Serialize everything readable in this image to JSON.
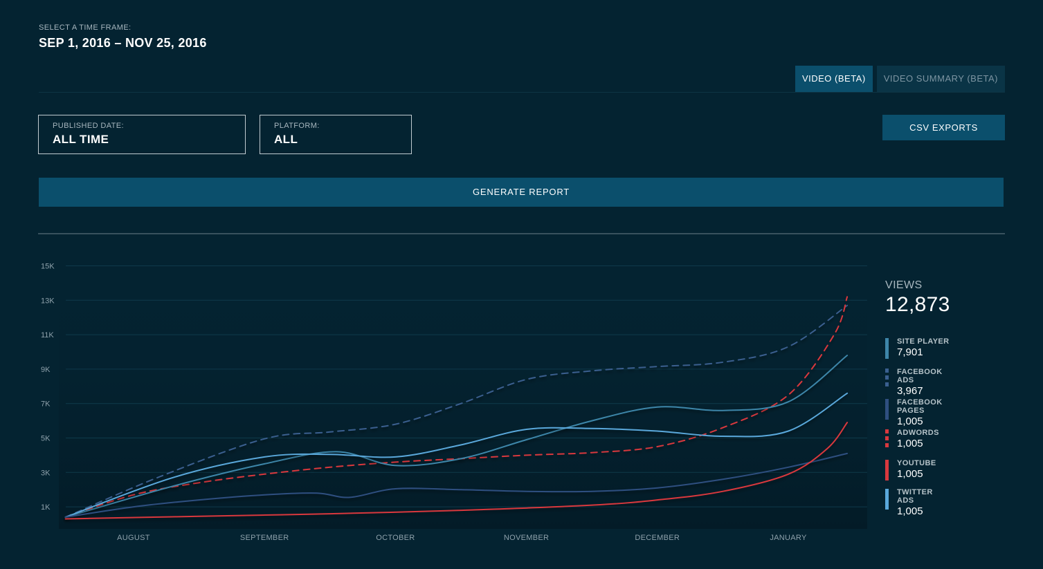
{
  "header": {
    "timeframe_label": "SELECT A TIME FRAME:",
    "timeframe_value": "SEP 1, 2016 – NOV 25, 2016"
  },
  "tabs": [
    {
      "label": "VIDEO (BETA)",
      "active": true
    },
    {
      "label": "VIDEO SUMMARY (BETA)",
      "active": false
    }
  ],
  "filters": {
    "published_date": {
      "label": "PUBLISHED DATE:",
      "value": "ALL TIME"
    },
    "platform": {
      "label": "PLATFORM:",
      "value": "ALL"
    }
  },
  "buttons": {
    "csv_exports": "CSV EXPORTS",
    "generate_report": "GENERATE REPORT"
  },
  "legend": {
    "title": "VIEWS",
    "total": "12,873",
    "items": [
      {
        "name": "SITE PLAYER",
        "value": "7,901",
        "color": "#3e86a9",
        "dashed": false
      },
      {
        "name": "FACEBOOK ADS",
        "value": "3,967",
        "color": "#3a5f8f",
        "dashed": true
      },
      {
        "name": "FACEBOOK PAGES",
        "value": "1,005",
        "color": "#2f4f80",
        "dashed": false
      },
      {
        "name": "ADWORDS",
        "value": "1,005",
        "color": "#d9383e",
        "dashed": true
      },
      {
        "name": "YOUTUBE",
        "value": "1,005",
        "color": "#d9383e",
        "dashed": false
      },
      {
        "name": "TWITTER ADS",
        "value": "1,005",
        "color": "#5aa8db",
        "dashed": false
      }
    ]
  },
  "colors": {
    "background": "#042331",
    "accent": "#0b4f6c",
    "gridline": "#0f3a4b"
  },
  "chart_data": {
    "type": "line",
    "x_tick_labels": [
      "AUGUST",
      "SEPTEMBER",
      "OCTOBER",
      "NOVEMBER",
      "DECEMBER",
      "JANUARY"
    ],
    "y_tick_labels": [
      "1K",
      "3K",
      "5K",
      "7K",
      "9K",
      "11K",
      "13K",
      "15K"
    ],
    "y_ticks": [
      1000,
      3000,
      5000,
      7000,
      9000,
      11000,
      13000,
      15000
    ],
    "ylim": [
      0,
      15000
    ],
    "xlim": [
      0,
      5.55
    ],
    "grid": true,
    "legend_position": "right",
    "series": [
      {
        "name": "FACEBOOK ADS",
        "color": "#3a5f8f",
        "dashed": true,
        "points": [
          [
            -0.52,
            400
          ],
          [
            0.2,
            2750
          ],
          [
            1.0,
            4950
          ],
          [
            1.5,
            5350
          ],
          [
            2.0,
            5800
          ],
          [
            2.5,
            7000
          ],
          [
            3.0,
            8400
          ],
          [
            3.5,
            8900
          ],
          [
            4.0,
            9150
          ],
          [
            4.5,
            9400
          ],
          [
            5.0,
            10300
          ],
          [
            5.45,
            12700
          ]
        ]
      },
      {
        "name": "ADWORDS",
        "color": "#d9383e",
        "dashed": true,
        "points": [
          [
            -0.52,
            400
          ],
          [
            0.0,
            1700
          ],
          [
            0.5,
            2400
          ],
          [
            1.0,
            2900
          ],
          [
            1.5,
            3300
          ],
          [
            2.0,
            3600
          ],
          [
            2.5,
            3800
          ],
          [
            3.0,
            4000
          ],
          [
            3.5,
            4150
          ],
          [
            4.0,
            4500
          ],
          [
            4.5,
            5600
          ],
          [
            5.0,
            7500
          ],
          [
            5.35,
            11000
          ],
          [
            5.45,
            13200
          ]
        ]
      },
      {
        "name": "SITE PLAYER",
        "color": "#3e86a9",
        "dashed": false,
        "points": [
          [
            -0.52,
            400
          ],
          [
            0.3,
            2200
          ],
          [
            1.0,
            3500
          ],
          [
            1.55,
            4200
          ],
          [
            2.0,
            3400
          ],
          [
            2.5,
            3800
          ],
          [
            3.0,
            4900
          ],
          [
            3.5,
            6000
          ],
          [
            4.0,
            6800
          ],
          [
            4.5,
            6600
          ],
          [
            5.0,
            7100
          ],
          [
            5.45,
            9800
          ]
        ]
      },
      {
        "name": "TWITTER ADS",
        "color": "#5aa8db",
        "dashed": false,
        "points": [
          [
            -0.52,
            400
          ],
          [
            0.3,
            2700
          ],
          [
            1.0,
            3900
          ],
          [
            1.5,
            4050
          ],
          [
            2.0,
            3900
          ],
          [
            2.5,
            4600
          ],
          [
            3.0,
            5500
          ],
          [
            3.5,
            5550
          ],
          [
            4.0,
            5400
          ],
          [
            4.5,
            5100
          ],
          [
            5.0,
            5400
          ],
          [
            5.45,
            7600
          ]
        ]
      },
      {
        "name": "FACEBOOK PAGES",
        "color": "#2f4f80",
        "dashed": false,
        "points": [
          [
            -0.52,
            400
          ],
          [
            0.0,
            1000
          ],
          [
            0.5,
            1400
          ],
          [
            1.0,
            1700
          ],
          [
            1.4,
            1800
          ],
          [
            1.65,
            1550
          ],
          [
            2.0,
            2050
          ],
          [
            2.5,
            2000
          ],
          [
            3.0,
            1900
          ],
          [
            3.5,
            1900
          ],
          [
            4.0,
            2100
          ],
          [
            4.5,
            2600
          ],
          [
            5.0,
            3300
          ],
          [
            5.45,
            4100
          ]
        ]
      },
      {
        "name": "YOUTUBE",
        "color": "#d9383e",
        "dashed": false,
        "points": [
          [
            -0.52,
            300
          ],
          [
            0.5,
            450
          ],
          [
            1.5,
            600
          ],
          [
            2.5,
            800
          ],
          [
            3.5,
            1100
          ],
          [
            4.0,
            1400
          ],
          [
            4.5,
            1900
          ],
          [
            5.0,
            2900
          ],
          [
            5.3,
            4400
          ],
          [
            5.45,
            5900
          ]
        ]
      }
    ]
  }
}
